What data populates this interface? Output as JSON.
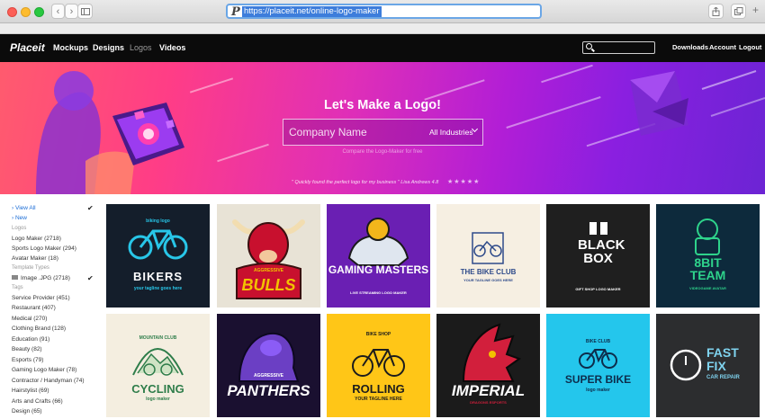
{
  "browser": {
    "url": "https://placeit.net/online-logo-maker",
    "site_icon": "P"
  },
  "nav": {
    "logo": "Placeit",
    "links": [
      "Mockups",
      "Designs",
      "Logos",
      "Videos"
    ],
    "right_links": [
      "Downloads",
      "Account",
      "Logout"
    ]
  },
  "hero": {
    "title": "Let's Make a Logo!",
    "input_placeholder": "Company Name",
    "industry_select": "All Industries",
    "hint": "Compare the Logo-Maker for free",
    "quote": "\" Quickly found the perfect logo for my business \" Lisa Andrews 4.8",
    "stars": "★★★★★"
  },
  "sidebar": {
    "view_all": "View All",
    "new": "New",
    "logos_header": "Logos",
    "logos": [
      "Logo Maker (2718)",
      "Sports Logo Maker (294)",
      "Avatar Maker (18)"
    ],
    "template_types_header": "Template Types",
    "template_type": "Image .JPG (2718)",
    "tags_header": "Tags",
    "tags": [
      "Service Provider (451)",
      "Restaurant (407)",
      "Medical (270)",
      "Clothing Brand (128)",
      "Education (91)",
      "Beauty (82)",
      "Esports (79)",
      "Gaming Logo Maker (78)",
      "Contractor / Handyman (74)",
      "Hairstylist (69)",
      "Arts and Crafts (66)",
      "Design (65)"
    ]
  },
  "tiles": [
    {
      "title": "BIKERS",
      "sub": "your tagline goes here",
      "top": "biking logo",
      "bg": "#141e2b",
      "fg": "#28c6e8"
    },
    {
      "title": "BULLS",
      "sub": "",
      "top": "AGGRESSIVE",
      "bg": "#e8e3d6",
      "fg": "#c8102e"
    },
    {
      "title": "GAMING MASTERS",
      "sub": "LIVE STREAMING LOGO MAKER",
      "top": "",
      "bg": "#6a1fb3",
      "fg": "#f2b61b"
    },
    {
      "title": "THE BIKE CLUB",
      "sub": "YOUR TAGLINE GOES HERE",
      "top": "",
      "bg": "#f6efe2",
      "fg": "#2e4a8a"
    },
    {
      "title": "BLACK BOX",
      "sub": "GIFT SHOP LOGO MAKER",
      "top": "",
      "bg": "#1f1f1f",
      "fg": "#ffffff"
    },
    {
      "title": "8BIT TEAM",
      "sub": "VIDEOGAME AVATAR",
      "top": "",
      "bg": "#0d2a3c",
      "fg": "#2ed38b"
    },
    {
      "title": "CYCLING",
      "sub": "logo maker",
      "top": "MOUNTAIN CLUB",
      "bg": "#f4eee0",
      "fg": "#2e7d4a"
    },
    {
      "title": "PANTHERS",
      "sub": "",
      "top": "AGGRESSIVE",
      "bg": "#1a1030",
      "fg": "#8b5cf6"
    },
    {
      "title": "ROLLING",
      "sub": "YOUR TAGLINE HERE",
      "top": "BIKE SHOP",
      "bg": "#ffc617",
      "fg": "#1c1c1c"
    },
    {
      "title": "IMPERIAL",
      "sub": "DRAGONS ESPORTS",
      "top": "",
      "bg": "#1b1b1b",
      "fg": "#d21f3c"
    },
    {
      "title": "SUPER BIKE",
      "sub": "logo maker",
      "top": "BIKE CLUB",
      "bg": "#24c6ec",
      "fg": "#0d2d4c"
    },
    {
      "title": "FAST FIX",
      "sub": "CAR REPAIR",
      "top": "",
      "bg": "#2c2d2f",
      "fg": "#7fd3ef"
    }
  ]
}
